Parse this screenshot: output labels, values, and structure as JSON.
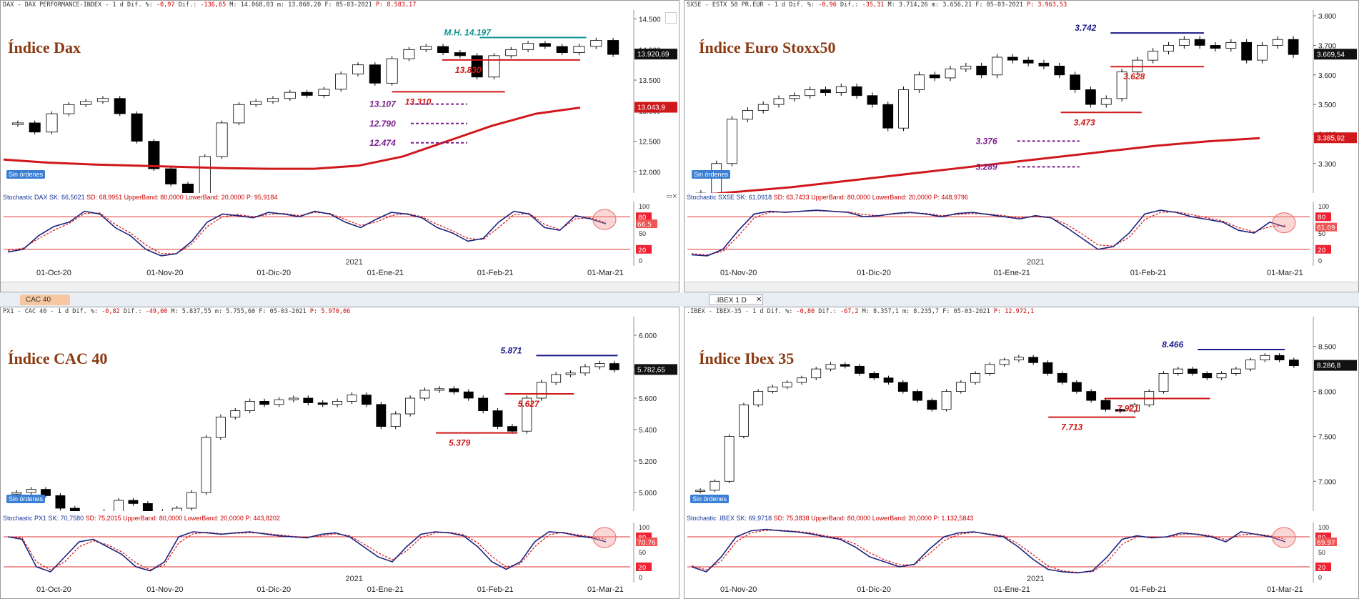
{
  "tabs": {
    "left": "CAC 40",
    "right": ".IBEX 1 D",
    "close": "✕"
  },
  "shared": {
    "sin_ordenes": "Sin órdenes",
    "year_label": "2021",
    "sto_upper": 80,
    "sto_lower": 20,
    "close_glyph": "▭×"
  },
  "panels": [
    {
      "id": "dax",
      "header": {
        "symbol": "DAX - DAX PERFORMANCE-INDEX -  1 d Dif. %: ",
        "pct": "-0,97",
        "mid": " Dif.: ",
        "dif": "-136,65",
        "rest": " M: 14.068,03 m: 13.868,20 F: 05-03-2021 ",
        "pp": "P: 8.583,17"
      },
      "stoch_header": {
        "name": "Stochastic DAX",
        "sk": "SK: 66,5021",
        "sd": "SD: 68,9951",
        "ub": "UpperBand: 80,0000",
        "lb": "LowerBand: 20,0000",
        "p": "P: 95,9184"
      },
      "chart_data": {
        "type": "candlestick",
        "title": "Índice Dax",
        "ylim": [
          11700,
          14600
        ],
        "y_ticks": [
          "14.500",
          "14.000",
          "13.500",
          "13.000",
          "12.500",
          "12.000"
        ],
        "y_tick_values": [
          14500,
          14000,
          13500,
          13000,
          12500,
          12000
        ],
        "x_ticks": [
          "01-Oct-20",
          "01-Nov-20",
          "01-Dic-20",
          "01-Ene-21",
          "01-Feb-21",
          "01-Mar-21"
        ],
        "last_price": "13.920,69",
        "ma_label": "13.043,9",
        "ma_color": "#d0181c",
        "path": [
          12800,
          12650,
          12950,
          13100,
          13150,
          13200,
          12950,
          12500,
          12050,
          11800,
          11550,
          12250,
          12800,
          13100,
          13150,
          13200,
          13300,
          13250,
          13350,
          13600,
          13750,
          13450,
          13850,
          14000,
          14050,
          13950,
          13900,
          13550,
          13900,
          14000,
          14100,
          14050,
          13950,
          14050,
          14150,
          13920
        ],
        "ma": [
          12200,
          12150,
          12120,
          12100,
          12080,
          12060,
          12050,
          12050,
          12100,
          12250,
          12500,
          12750,
          12950,
          13050
        ],
        "levels": [
          {
            "label": "M.H. 14.197",
            "value": 14197,
            "color": "#159393",
            "style": "solid",
            "x0": 0.76,
            "x1": 0.93
          },
          {
            "label": "13.830",
            "value": 13830,
            "color": "#d01818",
            "style": "solid",
            "x0": 0.7,
            "x1": 0.92
          },
          {
            "label": "13.310",
            "value": 13310,
            "color": "#d01818",
            "style": "solid",
            "x0": 0.62,
            "x1": 0.8
          },
          {
            "label": "13.107",
            "value": 13107,
            "color": "#7a1e8c",
            "style": "dashed",
            "x0": 0.65,
            "x1": 0.74
          },
          {
            "label": "12.790",
            "value": 12790,
            "color": "#7a1e8c",
            "style": "dashed",
            "x0": 0.65,
            "x1": 0.74
          },
          {
            "label": "12.474",
            "value": 12474,
            "color": "#7a1e8c",
            "style": "dashed",
            "x0": 0.65,
            "x1": 0.74
          }
        ],
        "stochastic": {
          "sk": [
            15,
            20,
            45,
            62,
            70,
            90,
            85,
            60,
            45,
            20,
            8,
            12,
            35,
            70,
            85,
            82,
            78,
            88,
            85,
            80,
            90,
            85,
            70,
            60,
            75,
            88,
            85,
            78,
            60,
            50,
            35,
            40,
            70,
            90,
            85,
            60,
            55,
            82,
            76,
            67
          ],
          "sd": [
            18,
            22,
            40,
            55,
            68,
            86,
            87,
            66,
            50,
            28,
            12,
            12,
            30,
            62,
            80,
            84,
            80,
            84,
            86,
            82,
            88,
            86,
            75,
            64,
            70,
            82,
            86,
            80,
            66,
            54,
            40,
            38,
            60,
            84,
            86,
            66,
            56,
            76,
            78,
            69
          ],
          "last_label": "66.5"
        }
      }
    },
    {
      "id": "sx5e",
      "header": {
        "symbol": "SX5E - ESTX 50 PR.EUR -  1 d Dif. %: ",
        "pct": "-0,96",
        "mid": " Dif.: ",
        "dif": "-35,31",
        "rest": " M: 3.714,26 m: 3.656,21 F: 05-03-2021 ",
        "pp": "P: 3.963,53"
      },
      "stoch_header": {
        "name": "Stochastic SX5E",
        "sk": "SK: 61,0918",
        "sd": "SD: 63,7433",
        "ub": "UpperBand: 80,0000",
        "lb": "LowerBand: 20,0000",
        "p": "P: 448,9796"
      },
      "chart_data": {
        "type": "candlestick",
        "title": "Índice Euro Stoxx50",
        "ylim": [
          3210,
          3810
        ],
        "y_ticks": [
          "3.800",
          "3.700",
          "3.600",
          "3.500",
          "3.400",
          "3.300"
        ],
        "y_tick_values": [
          3800,
          3700,
          3600,
          3500,
          3400,
          3300
        ],
        "x_ticks": [
          "01-Nov-20",
          "01-Dic-20",
          "01-Ene-21",
          "01-Feb-21",
          "01-Mar-21"
        ],
        "last_price": "3.669,54",
        "ma_label": "3.385,92",
        "ma_color": "#d0181c",
        "path": [
          3200,
          3300,
          3450,
          3480,
          3500,
          3520,
          3530,
          3550,
          3540,
          3560,
          3530,
          3500,
          3420,
          3550,
          3600,
          3590,
          3620,
          3630,
          3600,
          3660,
          3650,
          3640,
          3630,
          3600,
          3550,
          3500,
          3520,
          3610,
          3650,
          3680,
          3700,
          3720,
          3700,
          3690,
          3710,
          3650,
          3700,
          3720,
          3669
        ],
        "ma": [
          3190,
          3205,
          3220,
          3240,
          3260,
          3280,
          3300,
          3320,
          3340,
          3360,
          3375,
          3386
        ],
        "levels": [
          {
            "label": "3.742",
            "value": 3742,
            "color": "#1b1b8a",
            "style": "solid",
            "x0": 0.68,
            "x1": 0.83
          },
          {
            "label": "3.628",
            "value": 3628,
            "color": "#d01818",
            "style": "solid",
            "x0": 0.68,
            "x1": 0.83
          },
          {
            "label": "3.473",
            "value": 3473,
            "color": "#d01818",
            "style": "solid",
            "x0": 0.6,
            "x1": 0.73
          },
          {
            "label": "3.376",
            "value": 3376,
            "color": "#7a1e8c",
            "style": "dashed",
            "x0": 0.53,
            "x1": 0.63
          },
          {
            "label": "3.289",
            "value": 3289,
            "color": "#7a1e8c",
            "style": "dashed",
            "x0": 0.53,
            "x1": 0.63
          }
        ],
        "stochastic": {
          "sk": [
            10,
            8,
            20,
            55,
            85,
            90,
            88,
            90,
            92,
            90,
            88,
            80,
            82,
            86,
            88,
            85,
            80,
            86,
            88,
            84,
            80,
            76,
            82,
            78,
            60,
            40,
            20,
            25,
            50,
            85,
            92,
            88,
            80,
            75,
            70,
            55,
            50,
            70,
            61
          ],
          "sd": [
            12,
            10,
            16,
            45,
            78,
            88,
            89,
            90,
            91,
            90,
            89,
            84,
            82,
            85,
            87,
            86,
            82,
            84,
            86,
            85,
            82,
            78,
            80,
            78,
            66,
            48,
            28,
            26,
            42,
            75,
            88,
            89,
            84,
            78,
            72,
            60,
            52,
            62,
            64
          ],
          "last_label": "61.09"
        }
      }
    },
    {
      "id": "px1",
      "header": {
        "symbol": "PX1 - CAC 40 -  1 d Dif. %: ",
        "pct": "-0,82",
        "mid": " Dif.: ",
        "dif": "-49,00",
        "rest": " M: 5.837,55 m: 5.755,60 F: 05-03-2021 ",
        "pp": "P: 5.970,06"
      },
      "stoch_header": {
        "name": "Stochastic PX1",
        "sk": "SK: 70,7580",
        "sd": "SD: 75,2015",
        "ub": "UpperBand: 80,0000",
        "lb": "LowerBand: 20,0000",
        "p": "P: 443,8202"
      },
      "chart_data": {
        "type": "candlestick",
        "title": "Índice CAC 40",
        "ylim": [
          4900,
          6100
        ],
        "y_ticks": [
          "6.000",
          "5.800",
          "5.600",
          "5.400",
          "5.200",
          "5.000"
        ],
        "y_tick_values": [
          6000,
          5800,
          5600,
          5400,
          5200,
          5000
        ],
        "x_ticks": [
          "01-Oct-20",
          "01-Nov-20",
          "01-Dic-20",
          "01-Ene-21",
          "01-Feb-21",
          "01-Mar-21"
        ],
        "last_price": "5.782,65",
        "ma_label": "",
        "ma_color": "#d0181c",
        "path": [
          5000,
          5020,
          4980,
          4900,
          4850,
          4800,
          4880,
          4950,
          4930,
          4880,
          4820,
          4900,
          5000,
          5350,
          5480,
          5520,
          5580,
          5560,
          5590,
          5600,
          5570,
          5560,
          5580,
          5620,
          5560,
          5420,
          5500,
          5600,
          5650,
          5660,
          5640,
          5600,
          5520,
          5420,
          5390,
          5600,
          5700,
          5750,
          5760,
          5800,
          5820,
          5780
        ],
        "ma": [],
        "levels": [
          {
            "label": "5.871",
            "value": 5871,
            "color": "#1b1b8a",
            "style": "solid",
            "x0": 0.85,
            "x1": 0.98
          },
          {
            "label": "5.627",
            "value": 5627,
            "color": "#d01818",
            "style": "solid",
            "x0": 0.8,
            "x1": 0.91
          },
          {
            "label": "5.379",
            "value": 5379,
            "color": "#d01818",
            "style": "solid",
            "x0": 0.69,
            "x1": 0.82
          }
        ],
        "stochastic": {
          "sk": [
            80,
            75,
            20,
            10,
            40,
            70,
            75,
            60,
            45,
            20,
            12,
            30,
            80,
            90,
            88,
            85,
            88,
            90,
            86,
            82,
            80,
            78,
            85,
            88,
            80,
            60,
            40,
            30,
            60,
            85,
            90,
            88,
            82,
            60,
            30,
            15,
            30,
            70,
            90,
            88,
            82,
            78,
            70
          ],
          "sd": [
            80,
            78,
            30,
            14,
            30,
            60,
            72,
            64,
            50,
            28,
            14,
            24,
            68,
            86,
            89,
            86,
            87,
            88,
            87,
            84,
            81,
            79,
            82,
            86,
            82,
            66,
            48,
            34,
            52,
            78,
            88,
            89,
            84,
            68,
            40,
            20,
            26,
            60,
            84,
            89,
            84,
            80,
            75
          ],
          "last_label": "70.76"
        }
      }
    },
    {
      "id": "ibex",
      "header": {
        "symbol": ".IBEX - IBEX-35 -  1 d Dif. %: ",
        "pct": "-0,80",
        "mid": " Dif.: ",
        "dif": "-67,2",
        "rest": " M: 8.357,1 m: 8.235,7 F: 05-03-2021 ",
        "pp": "P: 12.972,1"
      },
      "stoch_header": {
        "name": "Stochastic .IBEX",
        "sk": "SK: 69,9718",
        "sd": "SD: 75,3838",
        "ub": "UpperBand: 80,0000",
        "lb": "LowerBand: 20,0000",
        "p": "P: 1.132,5843"
      },
      "chart_data": {
        "type": "candlestick",
        "title": "Índice Ibex 35",
        "ylim": [
          6700,
          8800
        ],
        "y_ticks": [
          "8.500",
          "8.000",
          "7.500",
          "7.000"
        ],
        "y_tick_values": [
          8500,
          8000,
          7500,
          7000
        ],
        "x_ticks": [
          "01-Nov-20",
          "01-Dic-20",
          "01-Ene-21",
          "01-Feb-21",
          "01-Mar-21"
        ],
        "last_price": "8.286,8",
        "ma_label": "",
        "ma_color": "#d0181c",
        "path": [
          6900,
          7000,
          7500,
          7850,
          8000,
          8050,
          8100,
          8150,
          8250,
          8300,
          8280,
          8200,
          8150,
          8100,
          8000,
          7900,
          7800,
          8000,
          8100,
          8200,
          8300,
          8350,
          8380,
          8320,
          8200,
          8100,
          8000,
          7900,
          7800,
          7780,
          7850,
          8000,
          8200,
          8250,
          8200,
          8150,
          8200,
          8250,
          8350,
          8400,
          8350,
          8286
        ],
        "ma": [],
        "levels": [
          {
            "label": "8.466",
            "value": 8466,
            "color": "#1b1b8a",
            "style": "solid",
            "x0": 0.82,
            "x1": 0.96
          },
          {
            "label": "7.921",
            "value": 7921,
            "color": "#d01818",
            "style": "solid",
            "x0": 0.67,
            "x1": 0.84
          },
          {
            "label": "7.713",
            "value": 7713,
            "color": "#d01818",
            "style": "solid",
            "x0": 0.58,
            "x1": 0.72
          }
        ],
        "stochastic": {
          "sk": [
            20,
            10,
            40,
            80,
            92,
            95,
            92,
            90,
            86,
            80,
            75,
            60,
            40,
            30,
            20,
            25,
            55,
            80,
            88,
            90,
            85,
            80,
            60,
            35,
            15,
            10,
            8,
            12,
            40,
            75,
            82,
            78,
            80,
            88,
            85,
            80,
            70,
            90,
            85,
            80,
            70
          ],
          "sd": [
            22,
            14,
            32,
            70,
            88,
            93,
            93,
            91,
            88,
            82,
            77,
            66,
            48,
            34,
            24,
            24,
            46,
            72,
            85,
            89,
            86,
            82,
            66,
            44,
            22,
            12,
            9,
            10,
            30,
            65,
            80,
            80,
            79,
            85,
            86,
            82,
            74,
            84,
            86,
            82,
            75
          ],
          "last_label": "69.97"
        }
      }
    }
  ]
}
